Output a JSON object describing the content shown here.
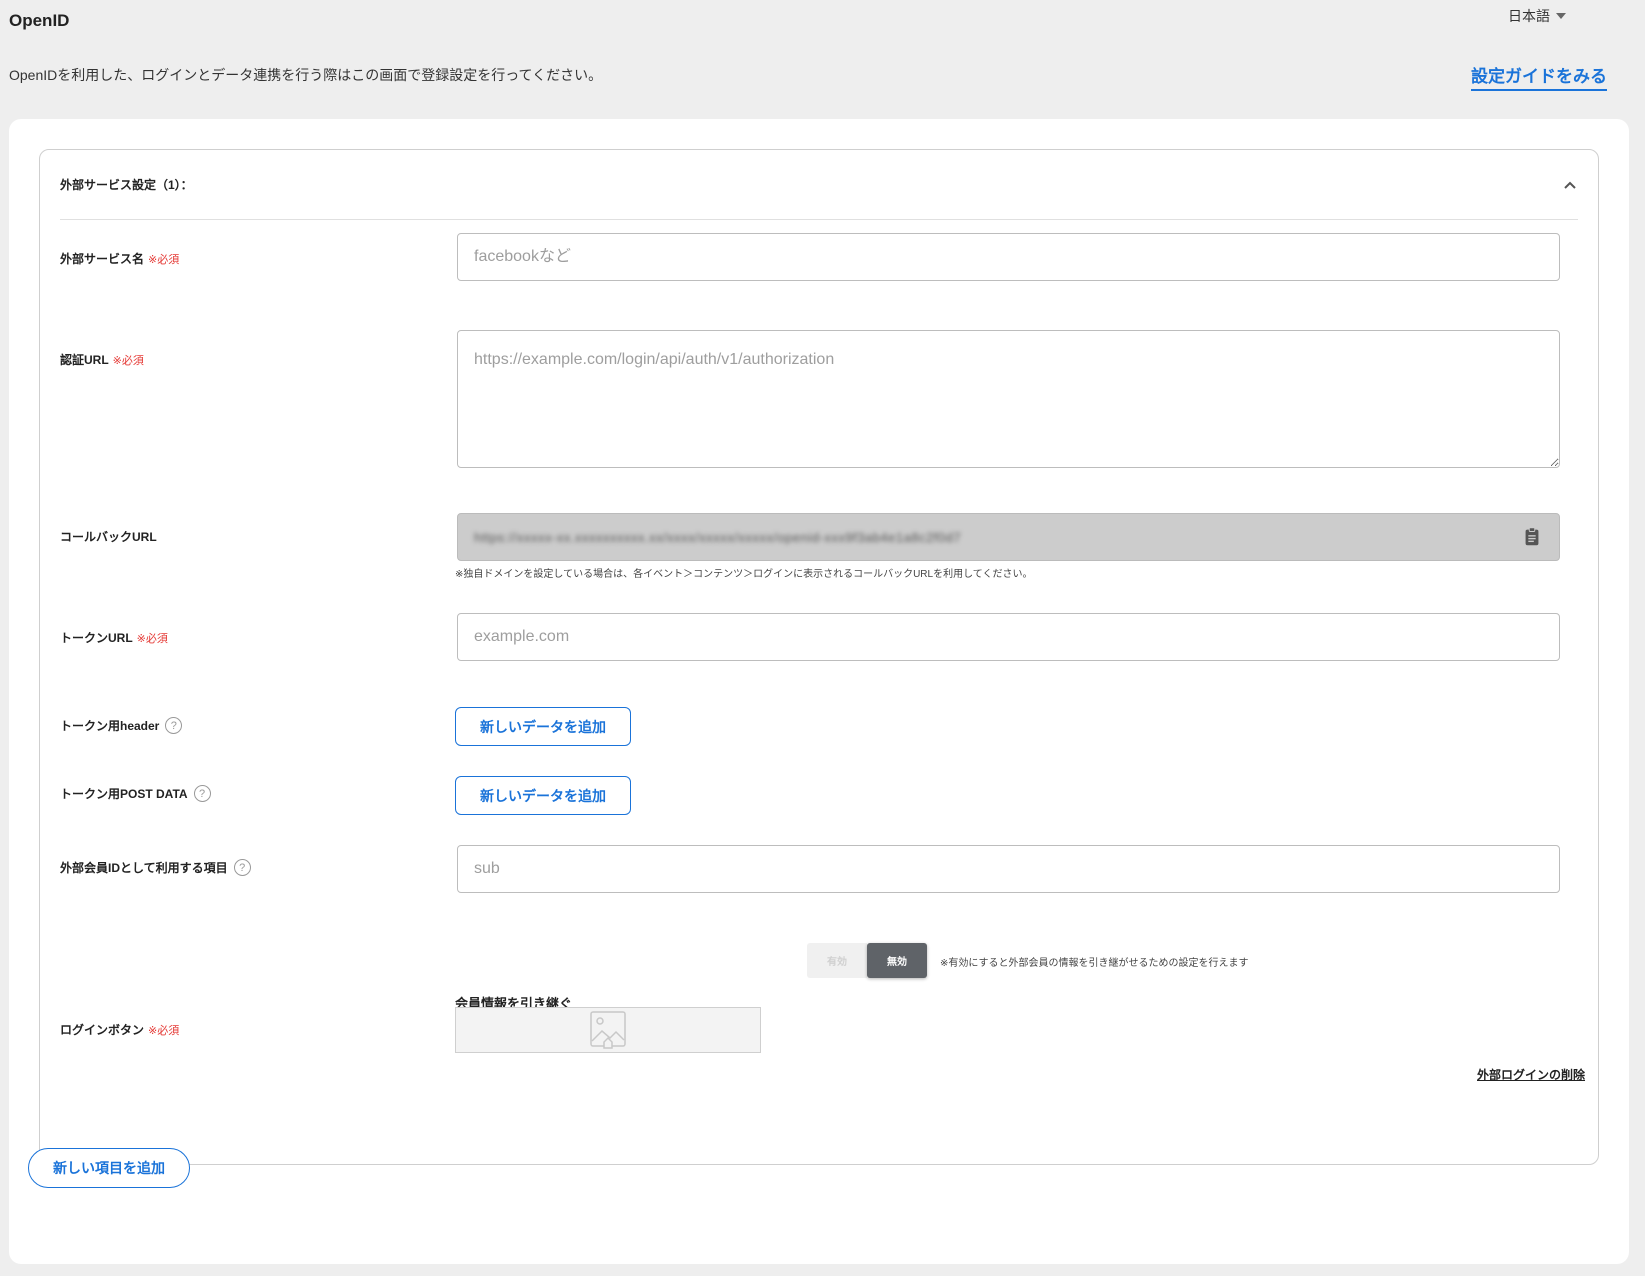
{
  "page": {
    "title": "OpenID",
    "language": "日本語",
    "description": "OpenIDを利用した、ログインとデータ連携を行う際はこの画面で登録設定を行ってください。",
    "guide_link": "設定ガイドをみる"
  },
  "section": {
    "title": "外部サービス設定（1）：",
    "required_mark": "※必須",
    "service_name": {
      "label": "外部サービス名",
      "placeholder": "facebookなど",
      "value": ""
    },
    "auth_url": {
      "label": "認証URL",
      "placeholder": "https://example.com/login/api/auth/v1/authorization",
      "value": ""
    },
    "callback_url": {
      "label": "コールバックURL",
      "value": "https://xxxxx-xx.xxxxxxxxxx.xx/xxxx/xxxxx/xxxxx/openid-xxx9f3ab4e1a8c2f0d7"
    },
    "callback_note": "※独自ドメインを設定している場合は、各イベント＞コンテンツ＞ログインに表示されるコールバックURLを利用してください。",
    "token_url": {
      "label": "トークンURL",
      "placeholder": "example.com",
      "value": ""
    },
    "token_header": {
      "label": "トークン用header",
      "button": "新しいデータを追加"
    },
    "token_post": {
      "label": "トークン用POST DATA",
      "button": "新しいデータを追加"
    },
    "external_id": {
      "label": "外部会員IDとして利用する項目",
      "placeholder": "sub",
      "value": ""
    },
    "member_transfer": {
      "label": "会員情報を引き継ぐ",
      "options": [
        "有効",
        "無効"
      ],
      "selected": "無効",
      "note": "※有効にすると外部会員の情報を引き継がせるための設定を行えます"
    },
    "login_button": {
      "label": "ログインボタン"
    },
    "delete_link": "外部ログインの削除"
  },
  "add_item_button": "新しい項目を追加",
  "colors": {
    "accent": "#1a73d9",
    "required": "#e53935",
    "toggle_active": "#5f6368"
  },
  "icons": [
    "chevron-up-icon",
    "help-icon",
    "clipboard-icon",
    "image-placeholder-icon",
    "caret-down-icon"
  ]
}
